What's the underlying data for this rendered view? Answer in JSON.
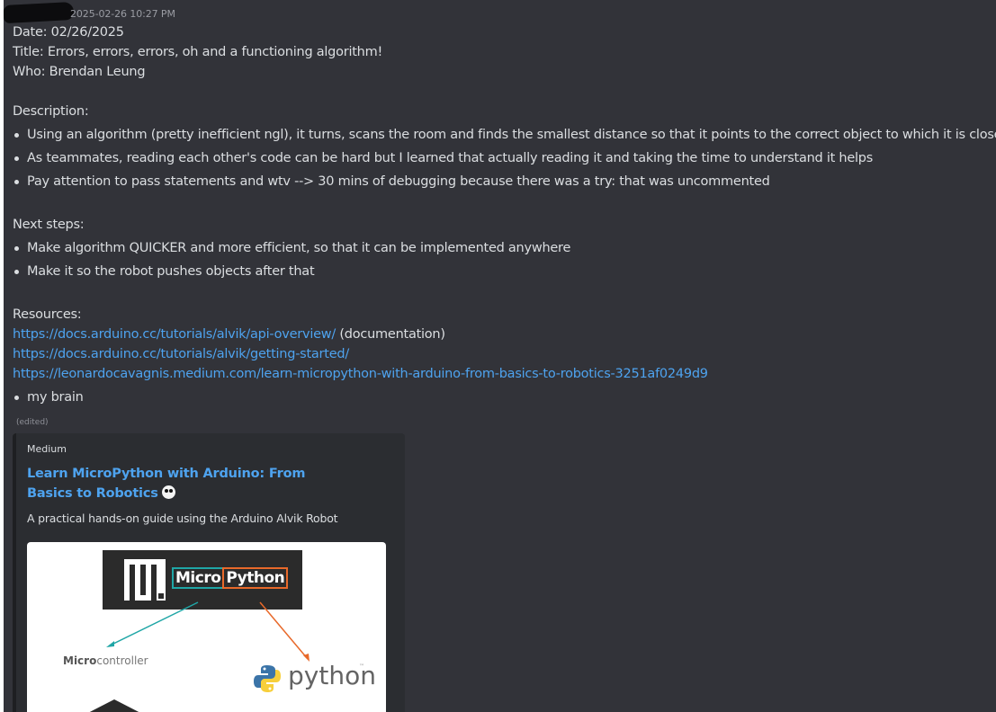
{
  "header": {
    "timestamp": "2025-02-26 10:27 PM"
  },
  "message": {
    "date_line": "Date: 02/26/2025",
    "title_line": "Title: Errors, errors, errors, oh and a functioning algorithm!",
    "who_line": "Who: Brendan Leung",
    "description_heading": "Description:",
    "description_items": [
      "Using an algorithm (pretty inefficient ngl), it turns, scans the room and finds the smallest distance so that it points to the correct object to which it is closest",
      "As teammates, reading each other's code can be hard but I learned that actually reading it and taking the time to understand it helps",
      "Pay attention to pass statements and wtv --> 30 mins of debugging because there was a try: that was uncommented"
    ],
    "next_steps_heading": "Next steps:",
    "next_steps_items": [
      "Make algorithm QUICKER and more efficient, so that it can be implemented anywhere",
      "Make it so the robot pushes objects after that"
    ],
    "resources_heading": "Resources:",
    "resources": [
      {
        "url": "https://docs.arduino.cc/tutorials/alvik/api-overview/",
        "note": " (documentation)"
      },
      {
        "url": "https://docs.arduino.cc/tutorials/alvik/getting-started/",
        "note": ""
      },
      {
        "url": "https://leonardocavagnis.medium.com/learn-micropython-with-arduino-from-basics-to-robotics-3251af0249d9",
        "note": ""
      }
    ],
    "resources_bullet": "my brain",
    "edited_label": "(edited)"
  },
  "embed": {
    "provider": "Medium",
    "title": "Learn MicroPython with Arduino: From Basics to Robotics",
    "description": "A practical hands-on guide using the Arduino Alvik Robot",
    "image": {
      "micro_word": "Micro",
      "python_word": "Python",
      "microcontroller_bold": "Micro",
      "microcontroller_rest": "controller",
      "python_label": "python",
      "python_tm": "™"
    }
  },
  "colors": {
    "background": "#323339",
    "text": "#dbdee1",
    "link": "#4ea3ef",
    "embed_bg": "#2b2d31"
  }
}
